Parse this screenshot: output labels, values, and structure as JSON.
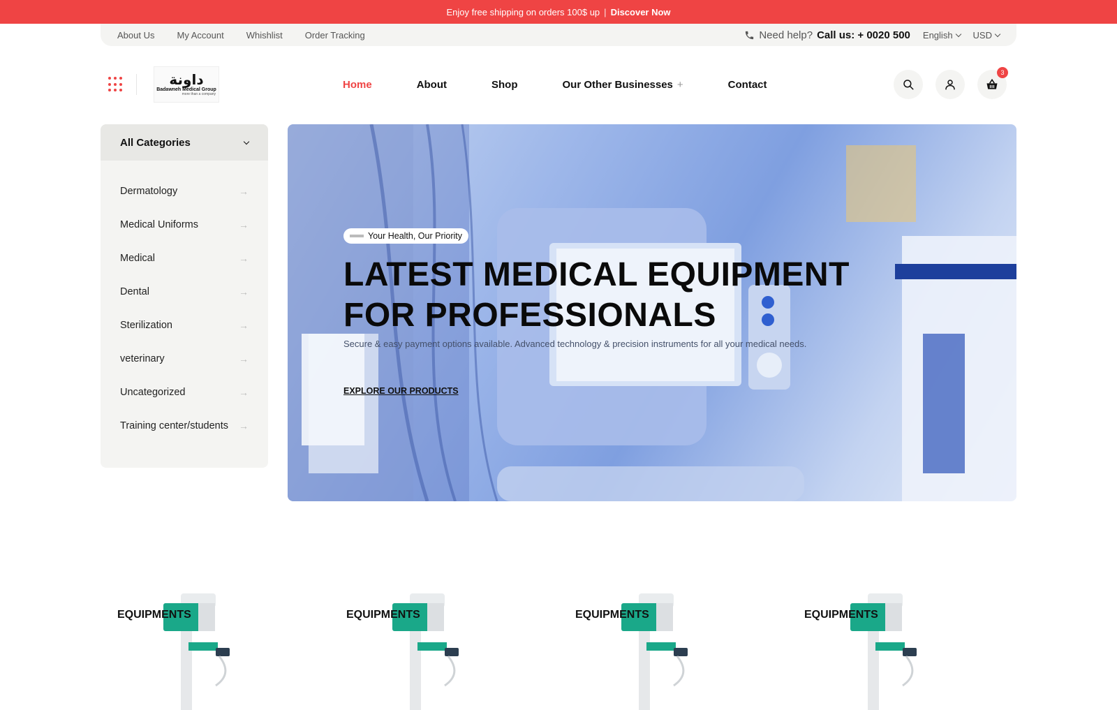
{
  "promo": {
    "text": "Enjoy free shipping on orders 100$ up",
    "separator": "|",
    "cta": "Discover Now"
  },
  "util": {
    "links": [
      "About Us",
      "My Account",
      "Whishlist",
      "Order Tracking"
    ],
    "help_label": "Need help?",
    "help_phone": "Call us: + 0020 500",
    "language": "English",
    "currency": "USD"
  },
  "header": {
    "logo": {
      "mark": "داونة",
      "name": "Badawneh Medical Group",
      "tagline": "more than a company"
    },
    "nav": [
      "Home",
      "About",
      "Shop",
      "Our Other Businesses",
      "Contact"
    ],
    "nav_plus": "+",
    "cart_count": "3"
  },
  "sidebar": {
    "title": "All Categories",
    "items": [
      "Dermatology",
      "Medical Uniforms",
      "Medical",
      "Dental",
      "Sterilization",
      "veterinary",
      "Uncategorized",
      "Training center/students"
    ],
    "arrow": "→"
  },
  "hero": {
    "pill": "Your Health, Our Priority",
    "title_line1": "LATEST MEDICAL EQUIPMENT",
    "title_line2": "FOR PROFESSIONALS",
    "subtitle": "Secure & easy payment options available. Advanced technology & precision instruments for all your medical needs.",
    "cta": "EXPLORE OUR PRODUCTS"
  },
  "cards": [
    "EQUIPMENTS",
    "EQUIPMENTS",
    "EQUIPMENTS",
    "EQUIPMENTS"
  ],
  "colors": {
    "accent": "#ef4444",
    "panel": "#f4f4f2"
  }
}
